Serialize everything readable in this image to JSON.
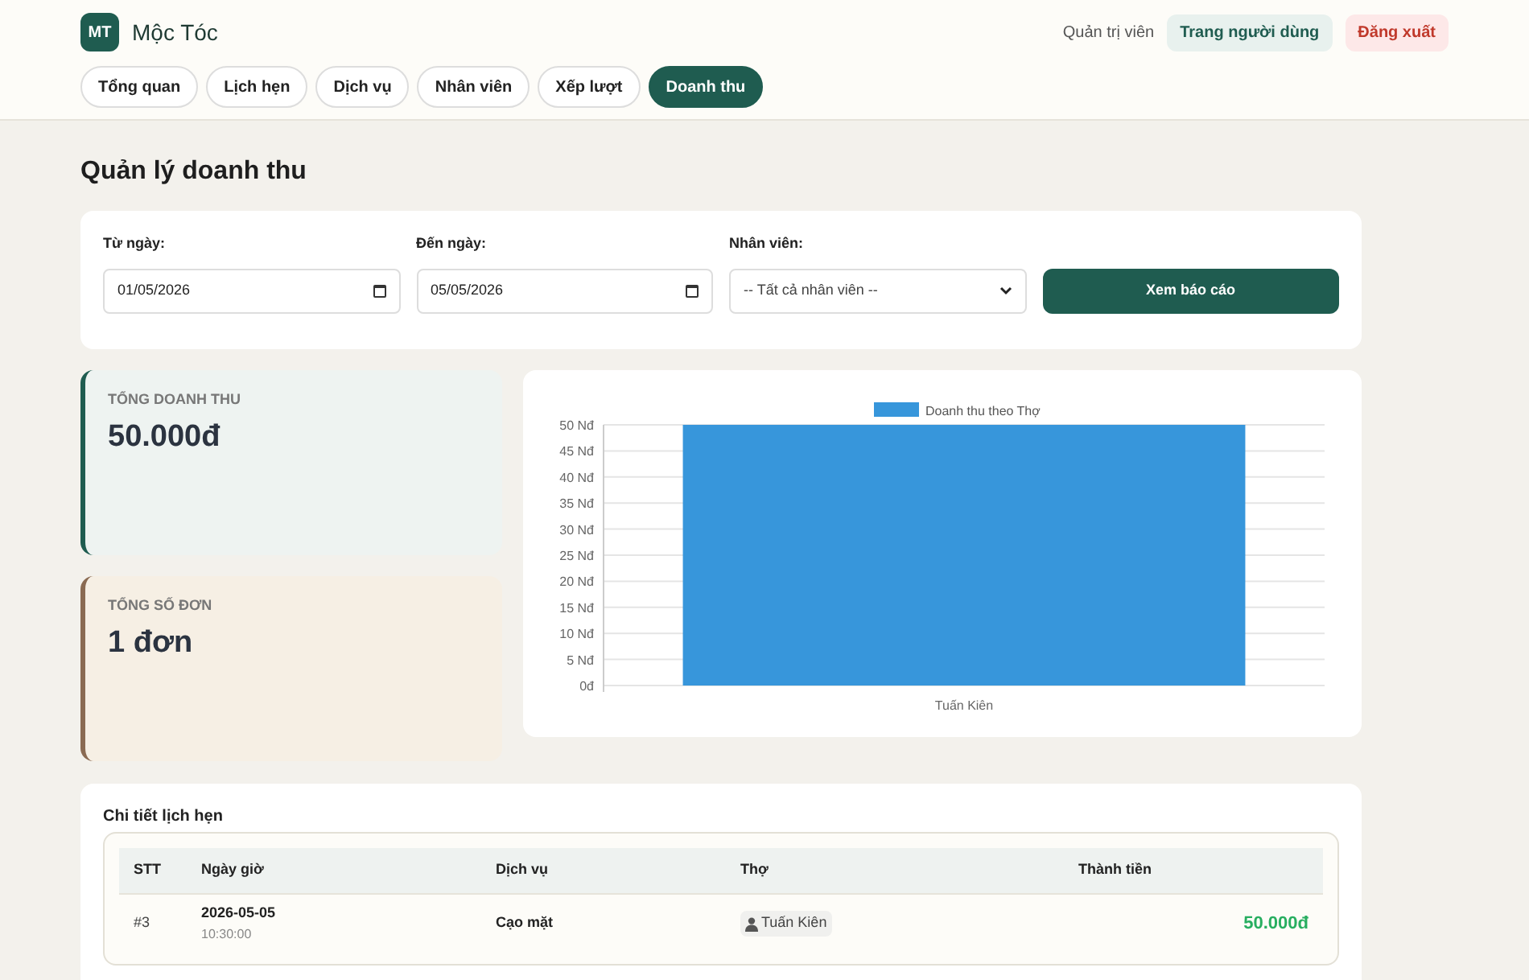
{
  "brand": {
    "logo": "MT",
    "name": "Mộc Tóc"
  },
  "user": {
    "role": "Quản trị viên",
    "user_page": "Trang người dùng",
    "logout": "Đăng xuất"
  },
  "tabs": [
    {
      "label": "Tổng quan",
      "selected": false
    },
    {
      "label": "Lịch hẹn",
      "selected": false
    },
    {
      "label": "Dịch vụ",
      "selected": false
    },
    {
      "label": "Nhân viên",
      "selected": false
    },
    {
      "label": "Xếp lượt",
      "selected": false
    },
    {
      "label": "Doanh thu",
      "selected": true
    }
  ],
  "page_title": "Quản lý doanh thu",
  "filters": {
    "from_label": "Từ ngày:",
    "from_value": "01/05/2026",
    "to_label": "Đến ngày:",
    "to_value": "05/05/2026",
    "staff_label": "Nhân viên:",
    "staff_value": "-- Tất cả nhân viên --",
    "submit": "Xem báo cáo"
  },
  "stats": [
    {
      "label": "TỔNG DOANH THU",
      "value": "50.000đ",
      "color": "#1f5c50"
    },
    {
      "label": "TỔNG SỐ ĐƠN",
      "value": "1 đơn",
      "color": "#8a6a52"
    }
  ],
  "chart": {
    "chart_data": {
      "type": "bar",
      "categories": [
        "Tuấn Kiên"
      ],
      "series": [
        {
          "name": "Doanh thu theo Thợ",
          "color": "#3796db",
          "values": [
            50
          ]
        }
      ],
      "ylim": [
        0,
        50
      ],
      "grid": true,
      "yticks": [
        {
          "value": 0,
          "label": "0đ"
        },
        {
          "value": 5,
          "label": "5 Nđ"
        },
        {
          "value": 10,
          "label": "10 Nđ"
        },
        {
          "value": 15,
          "label": "15 Nđ"
        },
        {
          "value": 20,
          "label": "20 Nđ"
        },
        {
          "value": 25,
          "label": "25 Nđ"
        },
        {
          "value": 30,
          "label": "30 Nđ"
        },
        {
          "value": 35,
          "label": "35 Nđ"
        },
        {
          "value": 40,
          "label": "40 Nđ"
        },
        {
          "value": 45,
          "label": "45 Nđ"
        },
        {
          "value": 50,
          "label": "50 Nđ"
        }
      ]
    }
  },
  "details": {
    "title": "Chi tiết lịch hẹn",
    "columns": [
      "STT",
      "Ngày giờ",
      "Dịch vụ",
      "Thợ",
      "Thành tiền"
    ],
    "rows": [
      {
        "stt": "#3",
        "date": "2026-05-05",
        "time": "10:30:00",
        "service": "Cạo mặt",
        "staff": "Tuấn Kiên",
        "amount": "50.000đ"
      }
    ]
  }
}
